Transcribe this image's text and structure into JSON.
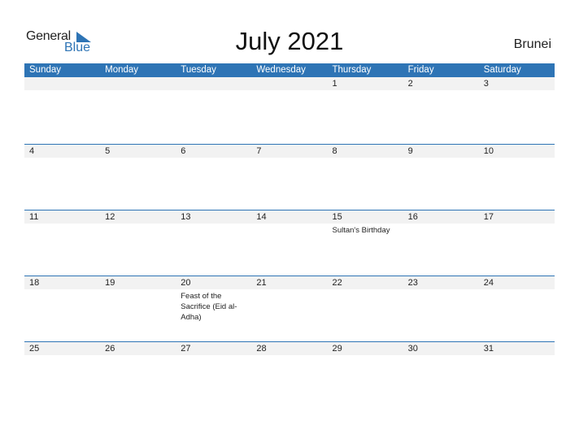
{
  "logo": {
    "general": "General",
    "blue": "Blue",
    "brand_color": "#2e74b5"
  },
  "title": "July 2021",
  "country": "Brunei",
  "days": [
    "Sunday",
    "Monday",
    "Tuesday",
    "Wednesday",
    "Thursday",
    "Friday",
    "Saturday"
  ],
  "weeks": [
    [
      {
        "d": ""
      },
      {
        "d": ""
      },
      {
        "d": ""
      },
      {
        "d": ""
      },
      {
        "d": "1"
      },
      {
        "d": "2"
      },
      {
        "d": "3"
      }
    ],
    [
      {
        "d": "4"
      },
      {
        "d": "5"
      },
      {
        "d": "6"
      },
      {
        "d": "7"
      },
      {
        "d": "8"
      },
      {
        "d": "9"
      },
      {
        "d": "10"
      }
    ],
    [
      {
        "d": "11"
      },
      {
        "d": "12"
      },
      {
        "d": "13"
      },
      {
        "d": "14"
      },
      {
        "d": "15",
        "note": "Sultan's Birthday"
      },
      {
        "d": "16"
      },
      {
        "d": "17"
      }
    ],
    [
      {
        "d": "18"
      },
      {
        "d": "19"
      },
      {
        "d": "20",
        "note": "Feast of the Sacrifice (Eid al-Adha)"
      },
      {
        "d": "21"
      },
      {
        "d": "22"
      },
      {
        "d": "23"
      },
      {
        "d": "24"
      }
    ],
    [
      {
        "d": "25"
      },
      {
        "d": "26"
      },
      {
        "d": "27"
      },
      {
        "d": "28"
      },
      {
        "d": "29"
      },
      {
        "d": "30"
      },
      {
        "d": "31"
      }
    ]
  ]
}
